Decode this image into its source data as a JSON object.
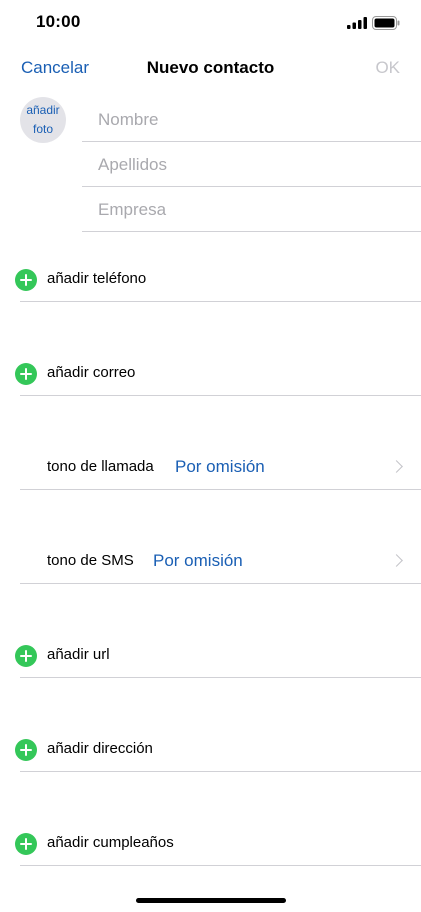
{
  "status": {
    "time": "10:00"
  },
  "nav": {
    "cancel": "Cancelar",
    "title": "Nuevo contacto",
    "ok": "OK"
  },
  "avatar": {
    "line1": "añadir",
    "line2": "foto"
  },
  "fields": {
    "first_name": {
      "placeholder": "Nombre",
      "value": ""
    },
    "last_name": {
      "placeholder": "Apellidos",
      "value": ""
    },
    "company": {
      "placeholder": "Empresa",
      "value": ""
    }
  },
  "rows": {
    "phone": "añadir teléfono",
    "email": "añadir correo",
    "ringtone_label": "tono de llamada",
    "ringtone_value": "Por omisión",
    "sms_label": "tono de SMS",
    "sms_value": "Por omisión",
    "url": "añadir url",
    "address": "añadir dirección",
    "birthday": "añadir cumpleaños"
  },
  "colors": {
    "accent": "#1a5fb4",
    "add": "#34c759",
    "separator": "#d1d1d6",
    "disabled": "#c7c7cc"
  }
}
